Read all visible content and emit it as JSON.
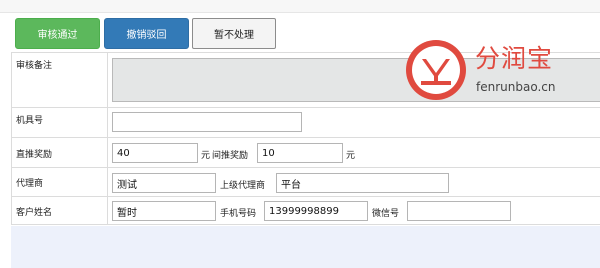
{
  "toolbar": {
    "approve_label": "审核通过",
    "reject_label": "撤销驳回",
    "ignore_label": "暂不处理"
  },
  "form": {
    "remark_label": "审核备注",
    "machine_label": "机具号",
    "machine_value": "",
    "direct_reward_label": "直推奖励",
    "direct_reward_value": "40",
    "direct_unit": "元",
    "indirect_reward_label": "间推奖励",
    "indirect_reward_value": "10",
    "indirect_unit": "元",
    "agent_label": "代理商",
    "agent_value": "测试",
    "parent_agent_label": "上级代理商",
    "parent_agent_value": "平台",
    "customer_label": "客户姓名",
    "customer_value": "暂时",
    "phone_label": "手机号码",
    "phone_value": "13999998899",
    "wechat_label": "微信号",
    "wechat_value": ""
  },
  "watermark": {
    "brand_cn": "分润宝",
    "brand_en": "fenrunbao.cn",
    "color": "#e04a3f"
  }
}
